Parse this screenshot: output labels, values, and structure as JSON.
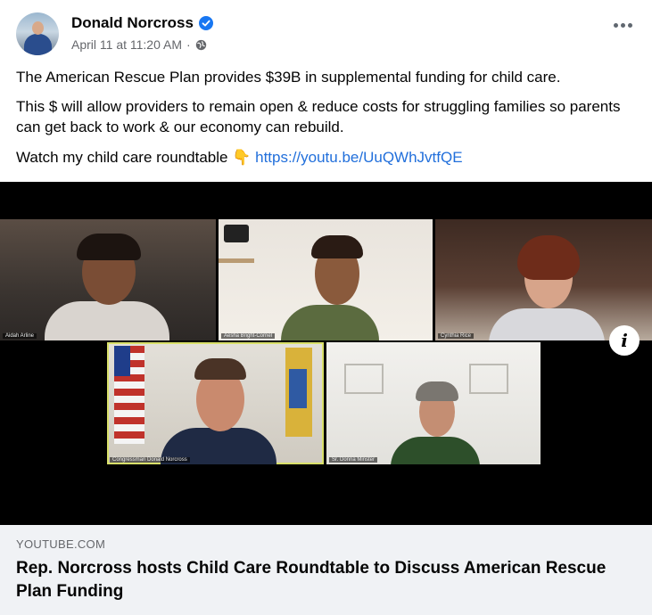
{
  "post": {
    "author": "Donald Norcross",
    "timestamp": "April 11 at 11:20 AM",
    "separator": "·",
    "verified": true,
    "privacy_icon": "globe-icon",
    "more_icon": "more-options-icon"
  },
  "body": {
    "line1": "The American Rescue Plan provides $39B in supplemental funding for child care.",
    "line2": "This $ will allow providers to remain open & reduce costs for struggling families so parents can get back to work & our economy can rebuild.",
    "line3_text": "Watch my child care roundtable",
    "line3_emoji": "👇",
    "line3_link": "https://youtu.be/UuQWhJvtfQE"
  },
  "video": {
    "participants": [
      "Aidah Arline",
      "Aesha Bright-Cornel",
      "Cynthia Rice",
      "Congressman Donald Norcross",
      "Sr. Donna Minster"
    ],
    "info_icon": "info-icon"
  },
  "link_preview": {
    "domain": "YOUTUBE.COM",
    "title": "Rep. Norcross hosts Child Care Roundtable to Discuss American Rescue Plan Funding"
  },
  "colors": {
    "link": "#216fdb",
    "verified": "#1877f2",
    "footer_bg": "#f0f2f5",
    "meta_text": "#65676b"
  }
}
